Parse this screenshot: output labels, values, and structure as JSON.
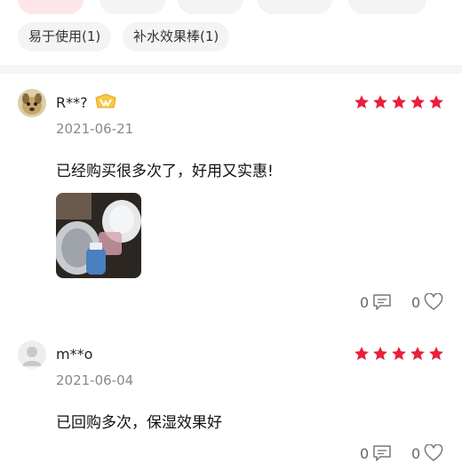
{
  "filter_tags": {
    "row1_partial": [
      "",
      "",
      "",
      "",
      ""
    ],
    "row2": [
      "易于使用(1)",
      "补水效果棒(1)"
    ]
  },
  "reviews": [
    {
      "username": "R**?",
      "avatar_icon": "dog-avatar",
      "badge_icon": "vip-badge-icon",
      "rating": 5,
      "date": "2021-06-21",
      "content": "已经购买很多次了，好用又实惠!",
      "photo": "product-photo",
      "comment_count": "0",
      "like_count": "0"
    },
    {
      "username": "m**o",
      "avatar_icon": "default-user-avatar",
      "rating": 5,
      "date": "2021-06-04",
      "content": "已回购多次，保湿效果好",
      "comment_count": "0",
      "like_count": "0"
    }
  ],
  "colors": {
    "star": "#e8203b",
    "active_tag_bg": "#fde6ea",
    "tag_bg": "#f4f4f4",
    "badge": "#f2b51b"
  }
}
